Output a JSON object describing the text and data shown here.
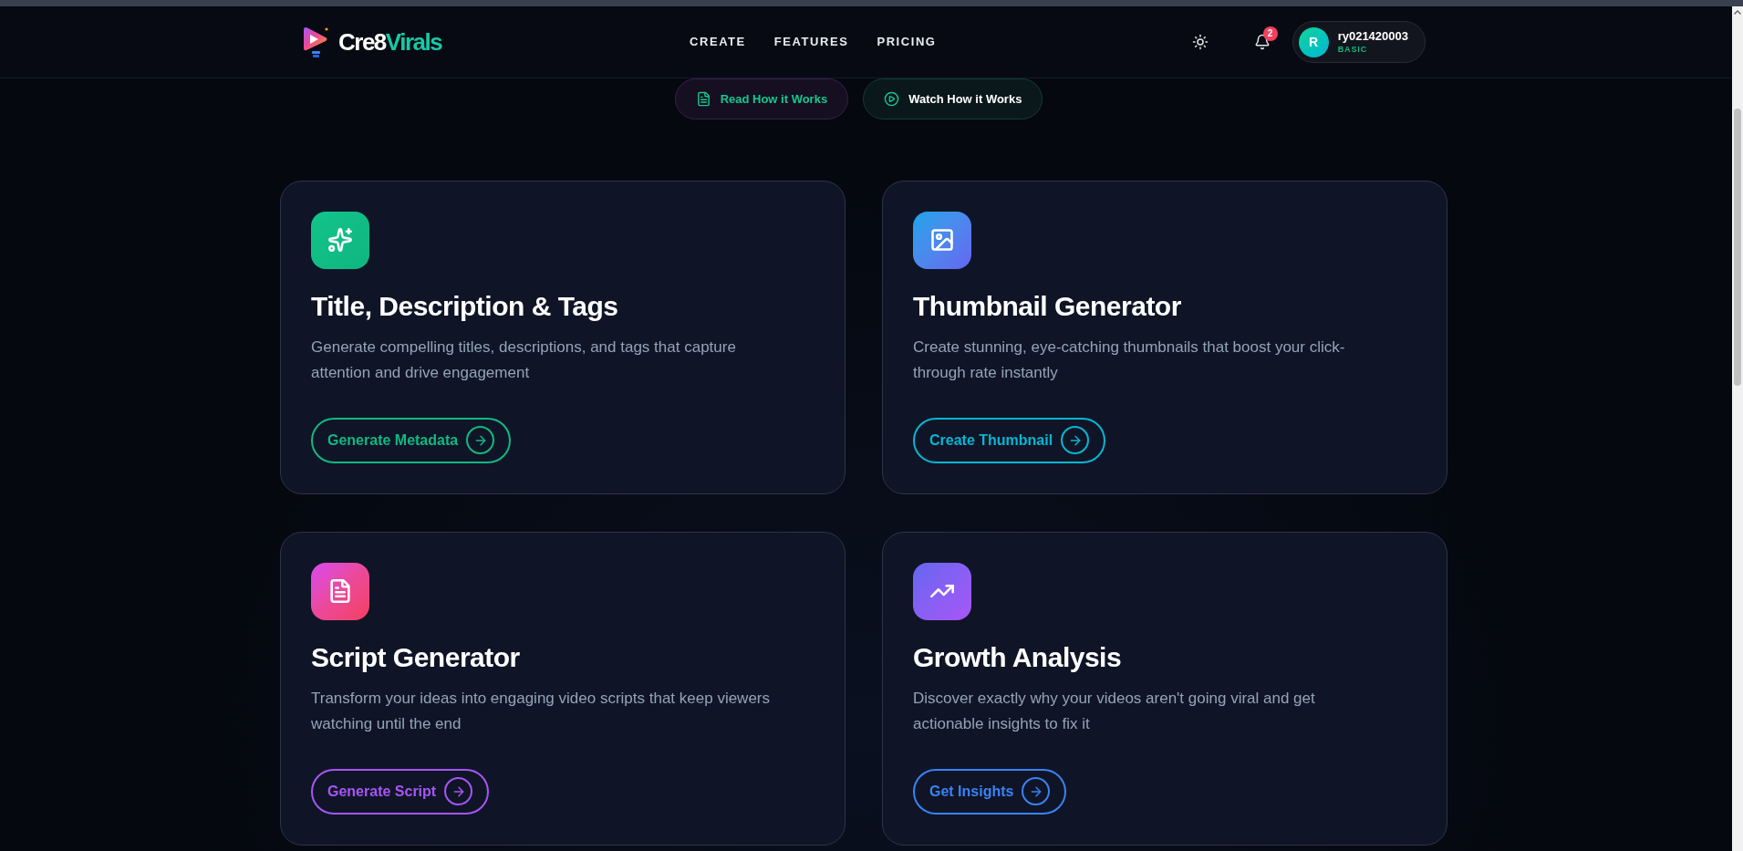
{
  "header": {
    "logo": {
      "prefix": "Cre8",
      "accent": "Virals"
    },
    "nav": [
      "CREATE",
      "FEATURES",
      "PRICING"
    ],
    "notifications": {
      "count": "2"
    },
    "user": {
      "initial": "R",
      "name": "ry021420003",
      "plan": "BASIC"
    }
  },
  "guide_buttons": [
    {
      "kind": "read",
      "label": "Read How it Works"
    },
    {
      "kind": "watch",
      "label": "Watch How it Works"
    }
  ],
  "cards": [
    {
      "title": "Title, Description & Tags",
      "description": "Generate compelling titles, descriptions, and tags that capture attention and drive engagement",
      "button": "Generate Metadata",
      "color": "#10b981"
    },
    {
      "title": "Thumbnail Generator",
      "description": "Create stunning, eye-catching thumbnails that boost your click-through rate instantly",
      "button": "Create Thumbnail",
      "color": "#06b6d4"
    },
    {
      "title": "Script Generator",
      "description": "Transform your ideas into engaging video scripts that keep viewers watching until the end",
      "button": "Generate Script",
      "color": "#a855f7"
    },
    {
      "title": "Growth Analysis",
      "description": "Discover exactly why your videos aren't going viral and get actionable insights to fix it",
      "button": "Get Insights",
      "color": "#3b82f6"
    }
  ]
}
